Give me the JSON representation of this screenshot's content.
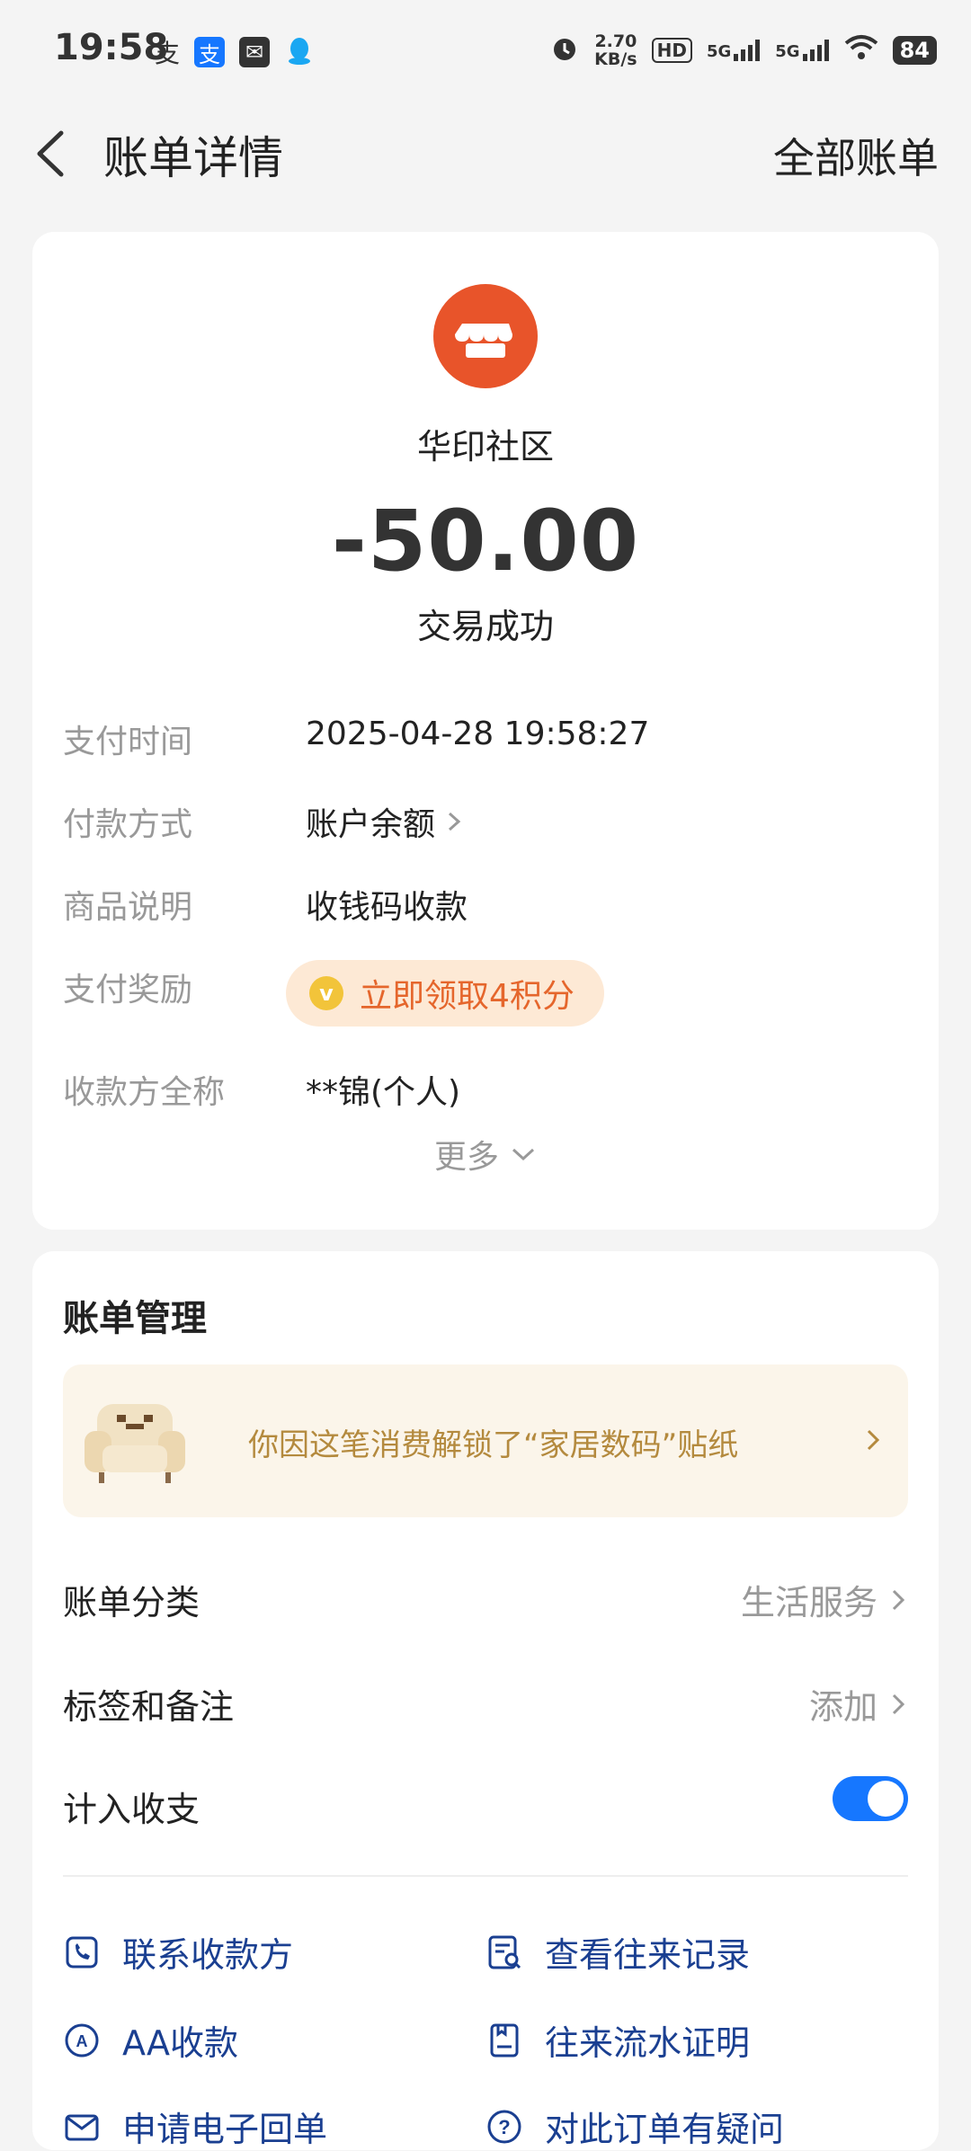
{
  "status_bar": {
    "time": "19:58",
    "net_speed_top": "2.70",
    "net_speed_bottom": "KB/s",
    "signal_1": "5G",
    "signal_2": "5G",
    "battery": "84"
  },
  "header": {
    "title": "账单详情",
    "right_link": "全部账单"
  },
  "transaction": {
    "merchant": "华印社区",
    "amount": "-50.00",
    "status": "交易成功",
    "details": [
      {
        "label": "支付时间",
        "value": "2025-04-28 19:58:27"
      },
      {
        "label": "付款方式",
        "value": "账户余额"
      },
      {
        "label": "商品说明",
        "value": "收钱码收款"
      },
      {
        "label": "支付奖励",
        "value": "立即领取4积分"
      },
      {
        "label": "收款方全称",
        "value": "**锦(个人)"
      }
    ],
    "more_label": "更多"
  },
  "management": {
    "title": "账单管理",
    "sticker_banner": "你因这笔消费解锁了“家居数码”贴纸",
    "rows": [
      {
        "label": "账单分类",
        "value": "生活服务"
      },
      {
        "label": "标签和备注",
        "value": "添加"
      },
      {
        "label": "计入收支",
        "value": ""
      }
    ],
    "include_in_stats": true,
    "actions": [
      {
        "label": "联系收款方",
        "icon": "phone-icon"
      },
      {
        "label": "查看往来记录",
        "icon": "record-search-icon"
      },
      {
        "label": "AA收款",
        "icon": "aa-icon"
      },
      {
        "label": "往来流水证明",
        "icon": "statement-icon"
      },
      {
        "label": "申请电子回单",
        "icon": "mail-icon"
      },
      {
        "label": "对此订单有疑问",
        "icon": "question-icon"
      }
    ]
  },
  "colors": {
    "accent_blue": "#1677ff",
    "merchant_orange": "#e8542a",
    "reward_text": "#e5662c",
    "link_navy": "#1a3f91"
  }
}
